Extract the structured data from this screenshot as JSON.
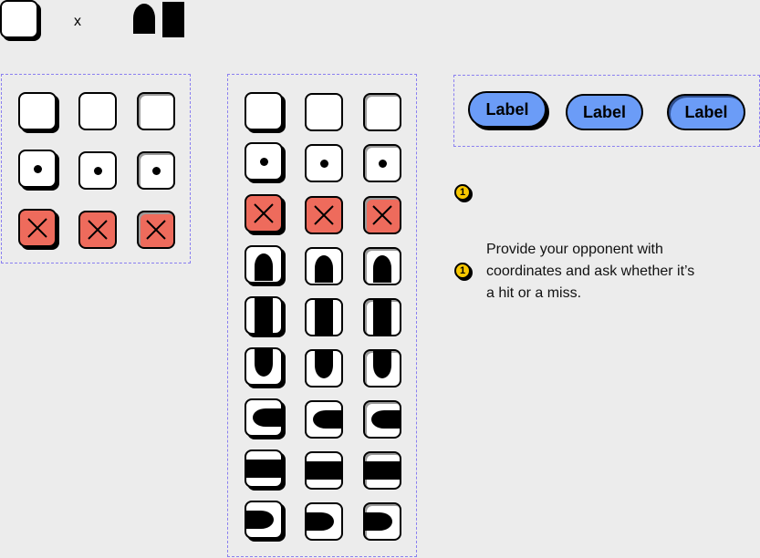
{
  "legend": {
    "x_label": "x"
  },
  "buttons": {
    "label_1": "Label",
    "label_2": "Label",
    "label_3": "Label"
  },
  "annotations": {
    "badge_1": "1",
    "badge_2": "1",
    "note_text": "Provide your opponent with coordinates and ask whether it’s a hit or a miss."
  },
  "colors": {
    "hit": "#ee6b5c",
    "button": "#6b9cf7",
    "badge": "#f8c800",
    "dash": "#8a7ff0"
  }
}
